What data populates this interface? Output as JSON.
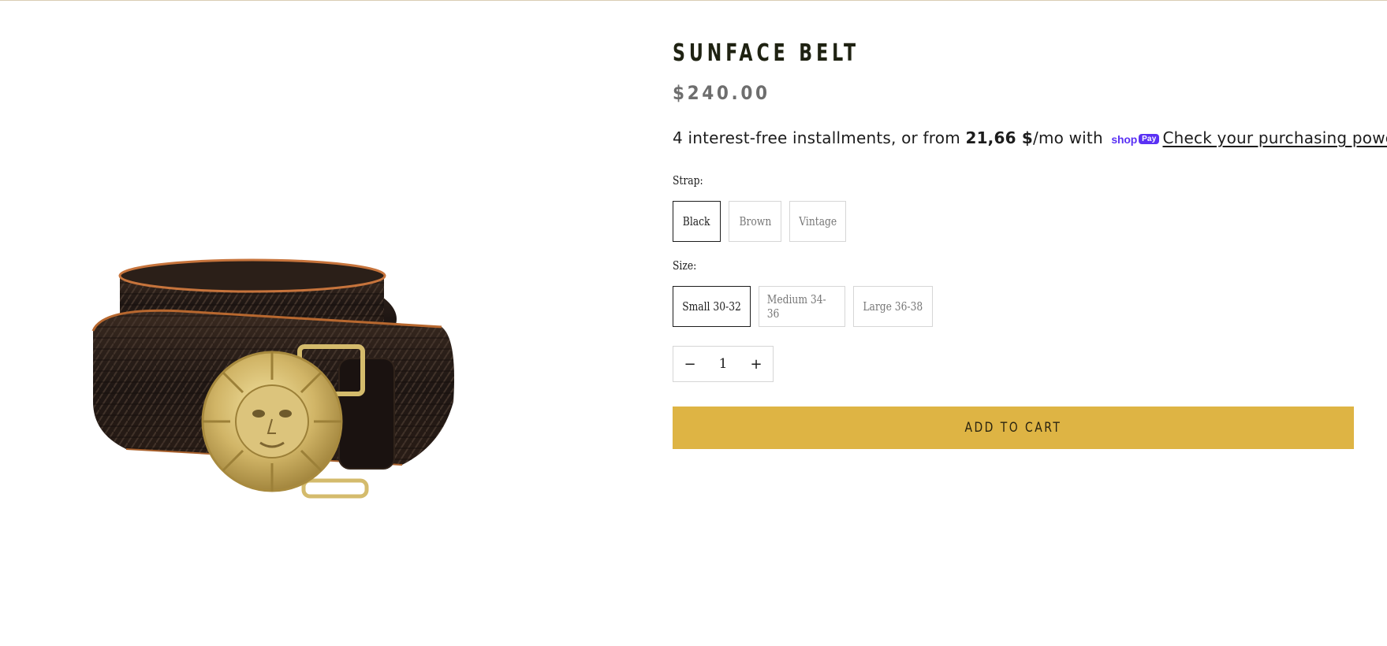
{
  "product": {
    "title": "SUNFACE BELT",
    "price": "$240.00",
    "image_alt_icon": "belt-product-image"
  },
  "installments": {
    "prefix": "4 interest-free installments, or from ",
    "amount": "21,66 $",
    "suffix": "/mo with ",
    "shoppay_text": "shop",
    "shoppay_pill": "Pay",
    "link": "Check your purchasing power"
  },
  "options": {
    "strap": {
      "label": "Strap:",
      "values": [
        "Black",
        "Brown",
        "Vintage"
      ],
      "selected": "Black"
    },
    "size": {
      "label": "Size:",
      "values": [
        "Small 30-32",
        "Medium 34-36",
        "Large 36-38"
      ],
      "selected": "Small 30-32"
    }
  },
  "quantity": {
    "minus": "−",
    "value": "1",
    "plus": "+"
  },
  "cart": {
    "add_label": "ADD TO CART"
  },
  "colors": {
    "accent_button": "#deb444",
    "shoppay": "#5a31f4",
    "top_rule": "#d9cdb4"
  }
}
